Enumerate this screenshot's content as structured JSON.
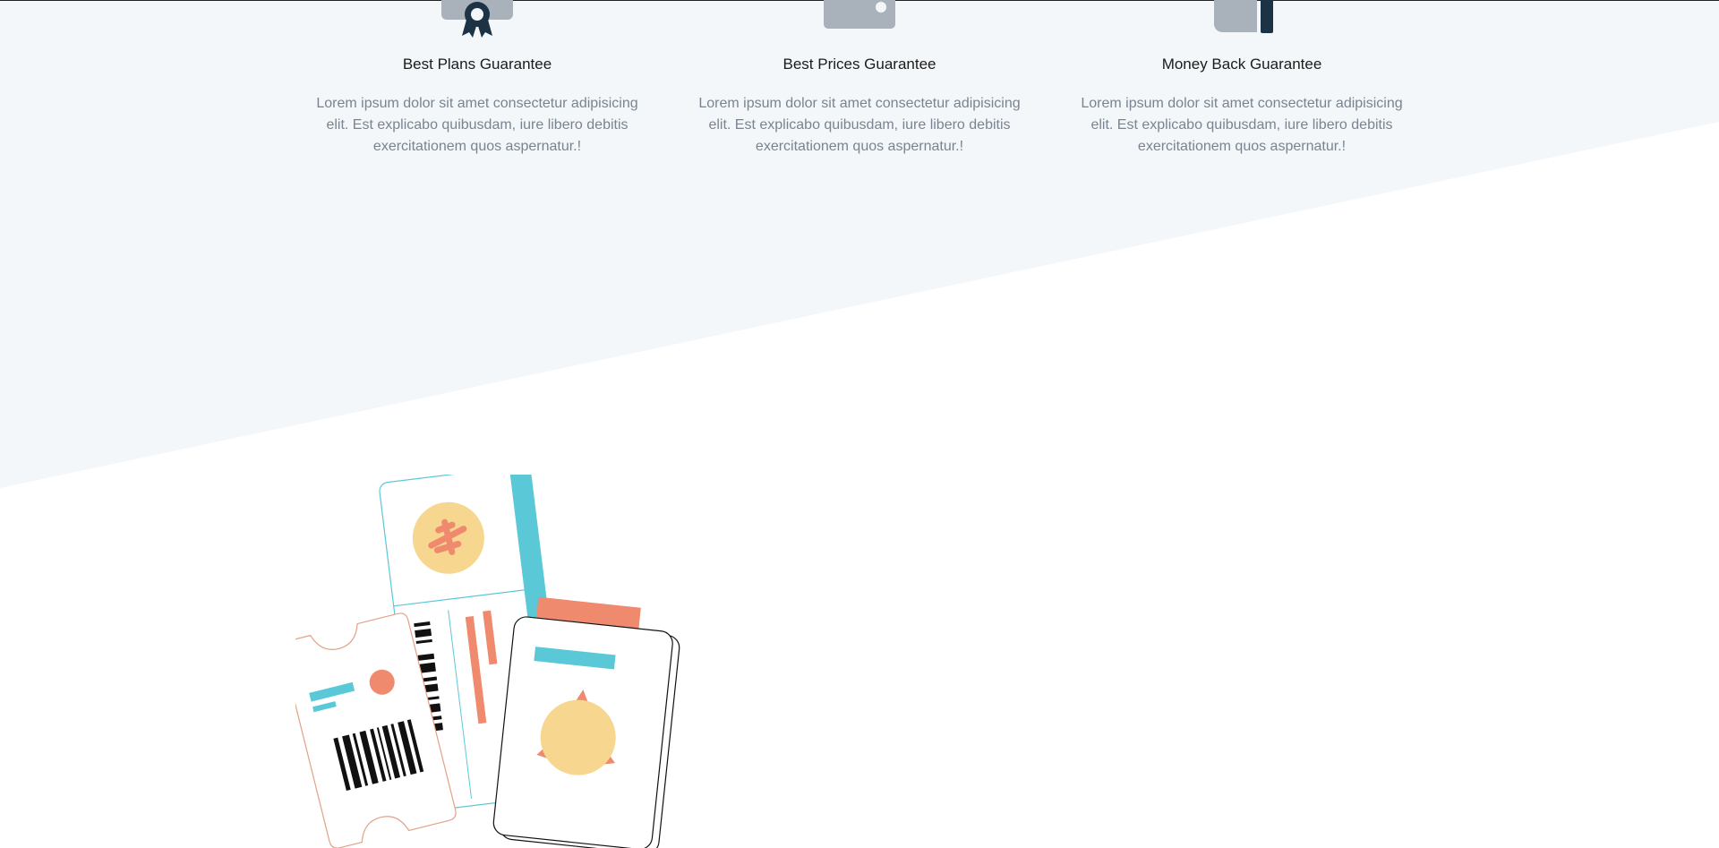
{
  "features": [
    {
      "title": "Best Plans Guarantee",
      "text": "Lorem ipsum dolor sit amet consectetur adipisicing elit. Est explicabo quibusdam, iure libero debitis exercitationem quos aspernatur.!",
      "icon": "award-ribbon-icon"
    },
    {
      "title": "Best Prices Guarantee",
      "text": "Lorem ipsum dolor sit amet consectetur adipisicing elit. Est explicabo quibusdam, iure libero debitis exercitationem quos aspernatur.!",
      "icon": "wallet-icon"
    },
    {
      "title": "Money Back Guarantee",
      "text": "Lorem ipsum dolor sit amet consectetur adipisicing elit. Est explicabo quibusdam, iure libero debitis exercitationem quos aspernatur.!",
      "icon": "money-hand-icon"
    }
  ],
  "colors": {
    "section_bg": "#f3f7fa",
    "icon_grey": "#a9b2bb",
    "icon_navy": "#1c3346",
    "accent_teal": "#5bc8d8",
    "accent_coral": "#ef8a6f",
    "accent_yellow": "#f7d68f"
  },
  "illustration": {
    "icon": "travel-tickets-passport-illustration"
  }
}
